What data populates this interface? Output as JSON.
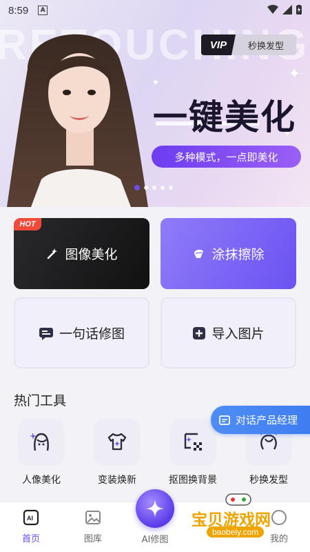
{
  "status_bar": {
    "time": "8:59",
    "notification_letter": "A"
  },
  "banner": {
    "background_word": "RETOUCHING",
    "vip_badge": "VIP",
    "vip_feature": "秒换发型",
    "headline": "一键美化",
    "subtitle": "多种模式，一点即美化",
    "carousel_count": 5,
    "carousel_active": 0
  },
  "cards": [
    {
      "label": "图像美化",
      "icon": "magic-wand-icon",
      "badge": "HOT"
    },
    {
      "label": "涂抹擦除",
      "icon": "eraser-icon"
    },
    {
      "label": "一句话修图",
      "icon": "chat-bubble-icon"
    },
    {
      "label": "导入图片",
      "icon": "plus-square-icon"
    }
  ],
  "hot_tools": {
    "title": "热门工具",
    "items": [
      {
        "label": "人像美化",
        "icon": "face-portrait-icon"
      },
      {
        "label": "变装焕新",
        "icon": "tshirt-icon"
      },
      {
        "label": "抠图换背景",
        "icon": "cutout-icon"
      },
      {
        "label": "秒换发型",
        "icon": "hairstyle-icon"
      }
    ]
  },
  "float_button": {
    "label": "对话产品经理",
    "icon": "chat-box-icon"
  },
  "tabbar": {
    "tabs": [
      {
        "label": "首页",
        "icon": "ai-home-icon",
        "active": true
      },
      {
        "label": "图库",
        "icon": "gallery-icon",
        "active": false
      },
      {
        "label": "AI修图",
        "icon": "ai-sparkle-icon",
        "active": false
      },
      {
        "label": "我的",
        "icon": "profile-icon",
        "active": false
      }
    ]
  },
  "watermark": {
    "text": "宝贝游戏网",
    "url": "baobeiy.com"
  },
  "colors": {
    "accent": "#6a4cf0",
    "hot": "#f04a3a",
    "float": "#3e7df0"
  }
}
